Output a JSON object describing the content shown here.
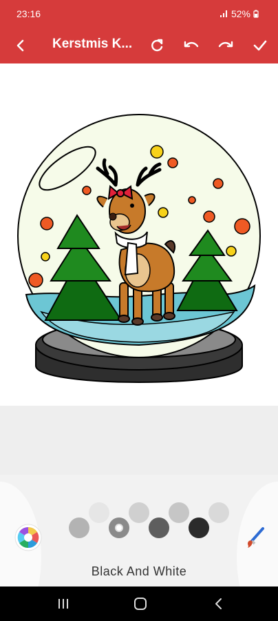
{
  "status": {
    "time": "23:16",
    "battery": "52%",
    "icons": [
      "signal-icon",
      "battery-icon"
    ]
  },
  "app_bar": {
    "title": "Kerstmis K...",
    "icons": [
      "back-arrow-icon",
      "refresh-icon",
      "undo-icon",
      "redo-icon",
      "check-icon"
    ]
  },
  "canvas": {
    "subject": "snow globe with reindeer and christmas trees",
    "colors": {
      "background": "#f6fbe9",
      "tree_dark": "#0f6b12",
      "tree_light": "#1f8a1f",
      "reindeer": "#c77a2a",
      "water": "#6cc6d4",
      "water_light": "#9ad8e2",
      "base": "#2e2e2e",
      "dot_red": "#ef5a24",
      "dot_yellow": "#f7d21a"
    }
  },
  "palette": {
    "name": "Black And White",
    "swatches": [
      {
        "color": "#b3b3b3",
        "selected": false
      },
      {
        "color": "#e6e6e6",
        "selected": false
      },
      {
        "color": "#8a8a8a",
        "selected": true
      },
      {
        "color": "#d0d0d0",
        "selected": false
      },
      {
        "color": "#5e5e5e",
        "selected": false
      },
      {
        "color": "#c6c6c6",
        "selected": false
      },
      {
        "color": "#2b2b2b",
        "selected": false
      },
      {
        "color": "#d9d9d9",
        "selected": false
      }
    ],
    "left_icon": "color-wheel-icon",
    "right_icon": "paintbrush-icon"
  },
  "nav": {
    "icons": [
      "recents-icon",
      "home-icon",
      "back-icon"
    ]
  },
  "colors": {
    "accent": "#d63b3b",
    "nav": "#000000"
  }
}
